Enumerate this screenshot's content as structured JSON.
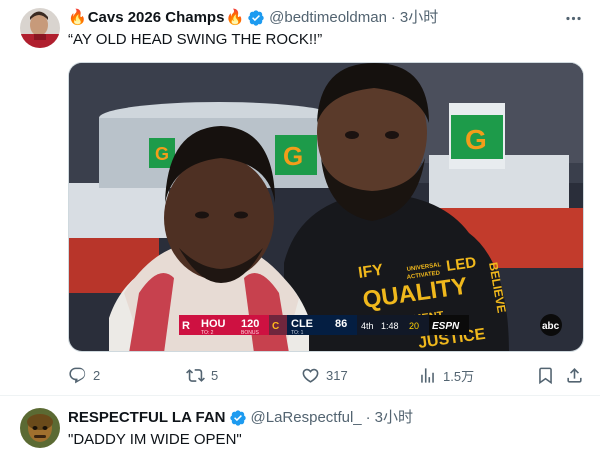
{
  "tweets": [
    {
      "author": {
        "display_name_prefix_icon": "fire-emoji",
        "display_name": "Cavs 2026 Champs",
        "display_name_suffix_icon": "fire-emoji",
        "handle": "@bedtimeoldman",
        "verified": true
      },
      "separator": "·",
      "time": "3小时",
      "text": "“AY OLD HEAD SWING THE ROCK!!”",
      "media": {
        "type": "photo",
        "scorebug": {
          "away_team": "HOU",
          "away_score": "120",
          "away_to": "TO: 2",
          "bonus_label": "BONUS",
          "home_team": "CLE",
          "home_score": "86",
          "home_to": "TO: 1",
          "quarter": "4th",
          "clock": "1:48",
          "shot_clock": "20",
          "network": "ESPN"
        },
        "watermark": "abc",
        "shirt_text": [
          "IFY",
          "UNIVERSAL",
          "ACTIVATED",
          "BELIEVE",
          "QUALITY",
          "COMMITMENT",
          "JUSTICE"
        ]
      },
      "actions": {
        "replies": "2",
        "retweets": "5",
        "likes": "317",
        "views": "1.5万"
      },
      "action_icons": [
        "reply-icon",
        "retweet-icon",
        "like-icon",
        "views-icon",
        "bookmark-icon",
        "share-icon"
      ]
    },
    {
      "author": {
        "display_name": "RESPECTFUL LA FAN",
        "handle": "@LaRespectful_",
        "verified": true
      },
      "separator": "·",
      "time": "3小时",
      "text": "\"DADDY IM WIDE OPEN\""
    }
  ],
  "colors": {
    "text_primary": "#0f1419",
    "text_secondary": "#536471",
    "verified_blue": "#1d9bf0",
    "divider": "#eff3f4"
  }
}
